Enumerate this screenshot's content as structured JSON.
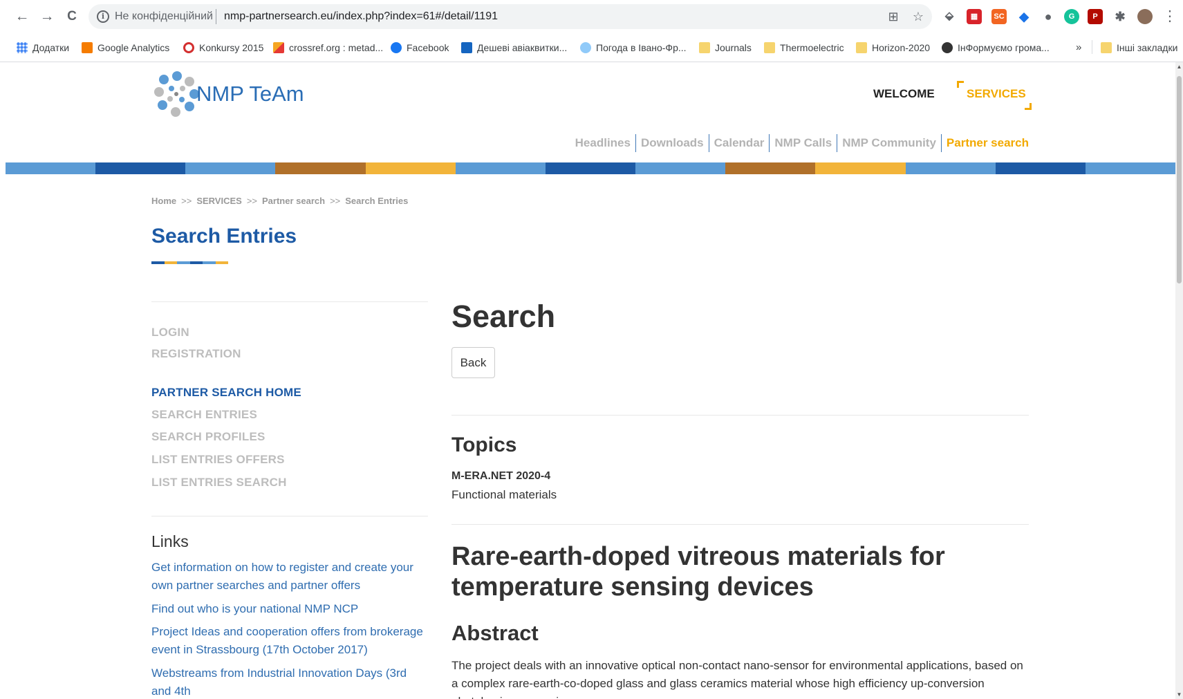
{
  "browser": {
    "security_label": "Не конфіденційний",
    "url": "nmp-partnersearch.eu/index.php?index=61#/detail/1191",
    "back_glyph": "←",
    "forward_glyph": "→",
    "reload_glyph": "C",
    "menu_glyph": "⋮",
    "translate_glyph": "⊞",
    "star_glyph": "☆",
    "bookmarks": [
      {
        "label": "Додатки",
        "icon": "apps-icon"
      },
      {
        "label": "Google Analytics",
        "icon": "analytics-icon"
      },
      {
        "label": "Konkursy 2015",
        "icon": "konkursy-icon"
      },
      {
        "label": "crossref.org : metad...",
        "icon": "crossref-icon"
      },
      {
        "label": "Facebook",
        "icon": "facebook-icon"
      },
      {
        "label": "Дешеві авіаквитки...",
        "icon": "flights-icon"
      },
      {
        "label": "Погода в Івано-Фр...",
        "icon": "weather-icon"
      },
      {
        "label": "Journals",
        "icon": "folder-icon"
      },
      {
        "label": "Thermoelectric",
        "icon": "folder-icon"
      },
      {
        "label": "Horizon-2020",
        "icon": "folder-icon"
      },
      {
        "label": "ІнФормуємо грома...",
        "icon": "inform-icon"
      }
    ],
    "overflow_label": "»",
    "other_bookmarks": "Інші закладки"
  },
  "header": {
    "logo_text": "NMP TeAm",
    "welcome": "WELCOME",
    "services": "SERVICES",
    "nav": [
      "Headlines",
      "Downloads",
      "Calendar",
      "NMP Calls",
      "NMP Community",
      "Partner search"
    ]
  },
  "colors": {
    "stripe": [
      "#5b9bd5",
      "#1d5aa5",
      "#5b9bd5",
      "#b0702a",
      "#f2b43a",
      "#5b9bd5",
      "#1d5aa5",
      "#5b9bd5",
      "#b0702a",
      "#f2b43a",
      "#5b9bd5",
      "#1d5aa5",
      "#5b9bd5"
    ]
  },
  "breadcrumb": {
    "items": [
      "Home",
      "SERVICES",
      "Partner search",
      "Search Entries"
    ],
    "separator": ">>"
  },
  "page_title": "Search Entries",
  "sidebar": {
    "login": "LOGIN",
    "registration": "REGISTRATION",
    "menu": [
      "PARTNER SEARCH HOME",
      "SEARCH ENTRIES",
      "SEARCH PROFILES",
      "LIST ENTRIES OFFERS",
      "LIST ENTRIES SEARCH"
    ],
    "links_title": "Links",
    "links": [
      "Get information on how to register and create your own partner searches and partner offers",
      "Find out who is your national NMP NCP",
      "Project Ideas and cooperation offers from brokerage event in Strassbourg (17th October 2017)",
      "Webstreams from Industrial Innovation Days (3rd and 4th"
    ]
  },
  "main": {
    "heading": "Search",
    "back_button": "Back",
    "topics_heading": "Topics",
    "topic_code": "M-ERA.NET 2020-4",
    "topic_name": "Functional materials",
    "entry_title": "Rare-earth-doped vitreous materials for temperature sensing devices",
    "abstract_heading": "Abstract",
    "abstract_text": "The project deals with an innovative optical non-contact nano-sensor for environmental applications, based on a complex rare-earth-co-doped glass and glass ceramics material whose high efficiency up-conversion photoluminescence in"
  }
}
